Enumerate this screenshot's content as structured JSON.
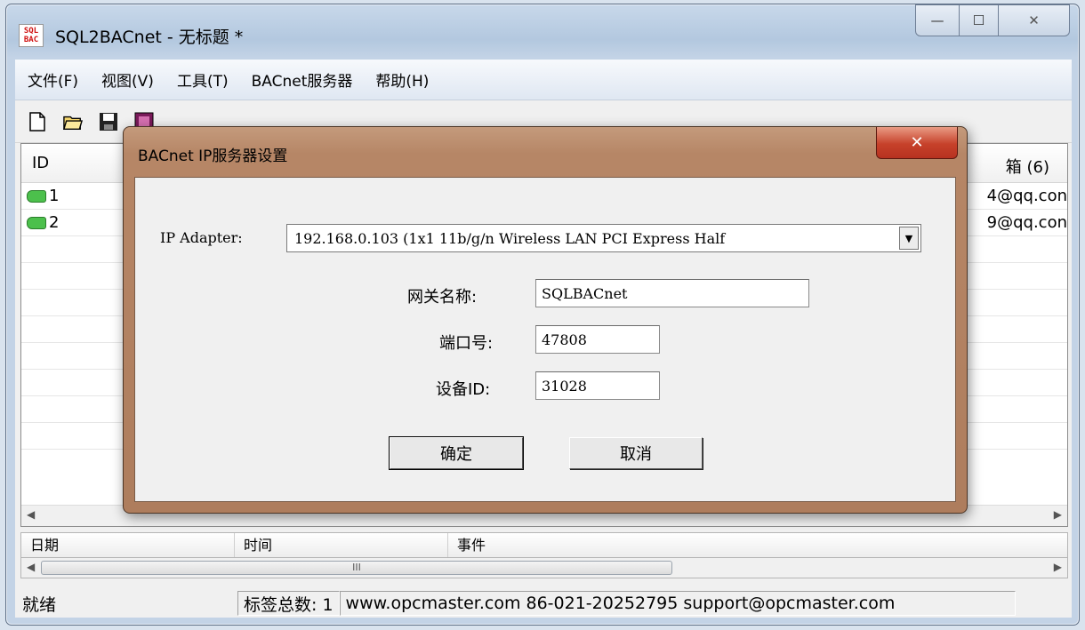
{
  "window": {
    "title": "SQL2BACnet - 无标题 *",
    "icon_text": "SQL BAC",
    "min_glyph": "—",
    "max_glyph": "☐",
    "close_glyph": "✕"
  },
  "menu": [
    "文件(F)",
    "视图(V)",
    "工具(T)",
    "BACnet服务器",
    "帮助(H)"
  ],
  "toolbar": [
    "new-file-icon",
    "open-folder-icon",
    "save-icon",
    "export-icon"
  ],
  "list": {
    "col_id": "ID",
    "col_right": "箱 (6)",
    "rows": [
      {
        "id": "1",
        "email": "4@qq.con"
      },
      {
        "id": "2",
        "email": "9@qq.con"
      }
    ]
  },
  "lower": {
    "cols": [
      "日期",
      "时间",
      "事件"
    ],
    "scroll_thumb": "III"
  },
  "status": {
    "ready": "就绪",
    "tag_count": "标签总数: 1",
    "contact": "www.opcmaster.com 86-021-20252795 support@opcmaster.com"
  },
  "dialog": {
    "title": "BACnet IP服务器设置",
    "close_glyph": "✕",
    "ip_adapter_label": "IP Adapter:",
    "ip_adapter_value": "192.168.0.103 (1x1 11b/g/n Wireless LAN PCI Express Half",
    "gateway_label": "网关名称:",
    "gateway_value": "SQLBACnet",
    "port_label": "端口号:",
    "port_value": "47808",
    "device_label": "设备ID:",
    "device_value": "31028",
    "ok_label": "确定",
    "cancel_label": "取消"
  }
}
